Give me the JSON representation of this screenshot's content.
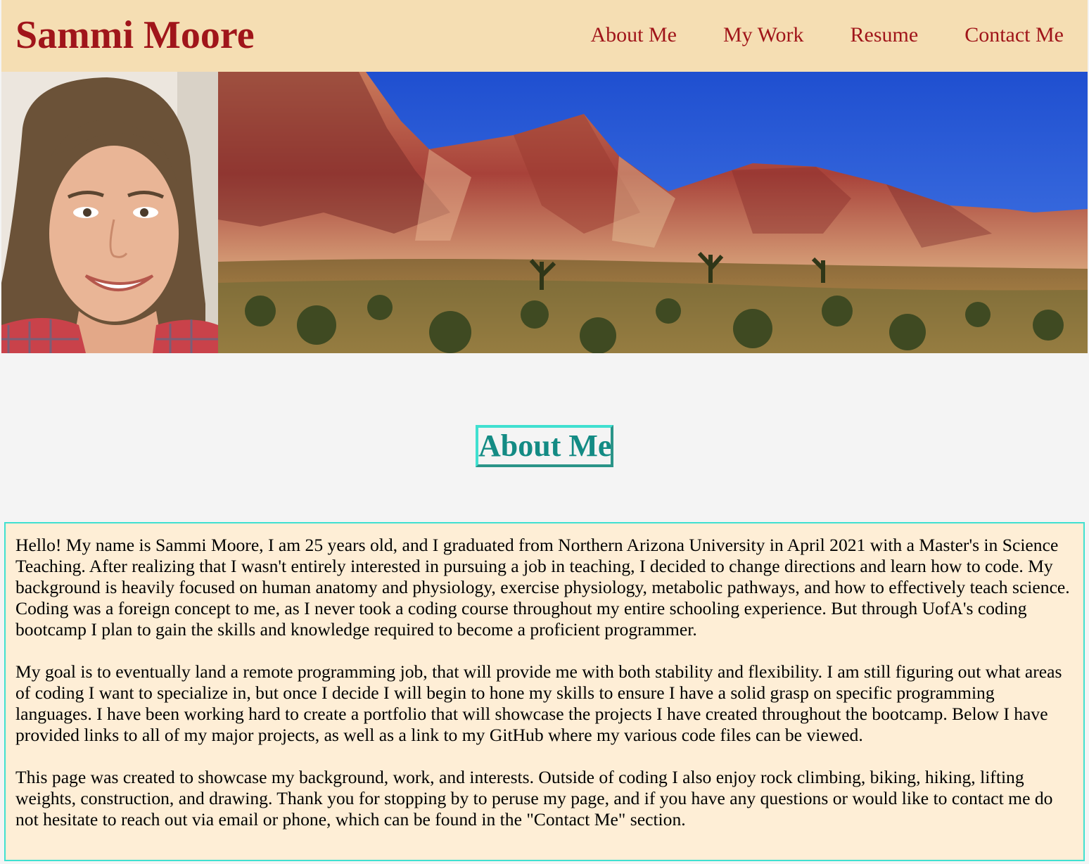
{
  "header": {
    "title": "Sammi Moore",
    "nav": [
      "About Me",
      "My Work",
      "Resume",
      "Contact Me"
    ]
  },
  "hero": {
    "portrait_alt": "portrait photo",
    "landscape_alt": "red rock desert mountains with joshua trees"
  },
  "about": {
    "heading": "About Me",
    "paragraphs": [
      "Hello! My name is Sammi Moore, I am 25 years old, and I graduated from Northern Arizona University in April 2021 with a Master's in Science Teaching. After realizing that I wasn't entirely interested in pursuing a job in teaching, I decided to change directions and learn how to code. My background is heavily focused on human anatomy and physiology, exercise physiology, metabolic pathways, and how to effectively teach science. Coding was a foreign concept to me, as I never took a coding course throughout my entire schooling experience. But through UofA's coding bootcamp I plan to gain the skills and knowledge required to become a proficient programmer.",
      "My goal is to eventually land a remote programming job, that will provide me with both stability and flexibility. I am still figuring out what areas of coding I want to specialize in, but once I decide I will begin to hone my skills to ensure I have a solid grasp on specific programming languages. I have been working hard to create a portfolio that will showcase the projects I have created throughout the bootcamp. Below I have provided links to all of my major projects, as well as a link to my GitHub where my various code files can be viewed.",
      "This page was created to showcase my background, work, and interests. Outside of coding I also enjoy rock climbing, biking, hiking, lifting weights, construction, and drawing. Thank you for stopping by to peruse my page, and if you have any questions or would like to contact me do not hesitate to reach out via email or phone, which can be found in the \"Contact Me\" section."
    ]
  },
  "colors": {
    "header_bg": "#f5deb3",
    "brand_red": "#a0151a",
    "accent_teal": "#40e0d0",
    "heading_teal": "#138b84",
    "about_bg": "#feeed6",
    "page_bg": "#f4f4f4"
  }
}
